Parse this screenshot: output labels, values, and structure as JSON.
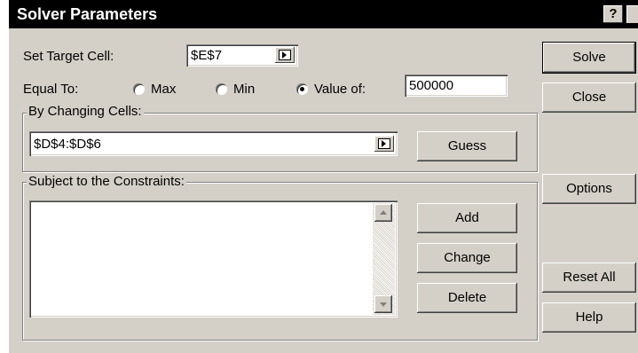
{
  "dialog": {
    "title": "Solver Parameters",
    "help_glyph": "?"
  },
  "target": {
    "label": "Set Target Cell:",
    "value": "$E$7"
  },
  "equal_to": {
    "label": "Equal To:",
    "options": [
      {
        "label": "Max",
        "selected": false
      },
      {
        "label": "Min",
        "selected": false
      },
      {
        "label": "Value of:",
        "selected": true
      }
    ],
    "value": "500000"
  },
  "changing": {
    "legend": "By Changing Cells:",
    "value": "$D$4:$D$6",
    "guess_label": "Guess"
  },
  "constraints": {
    "legend": "Subject to the Constraints:",
    "items": [],
    "add_label": "Add",
    "change_label": "Change",
    "delete_label": "Delete"
  },
  "side_buttons": {
    "solve": "Solve",
    "close": "Close",
    "options": "Options",
    "reset_all": "Reset All",
    "help": "Help"
  }
}
